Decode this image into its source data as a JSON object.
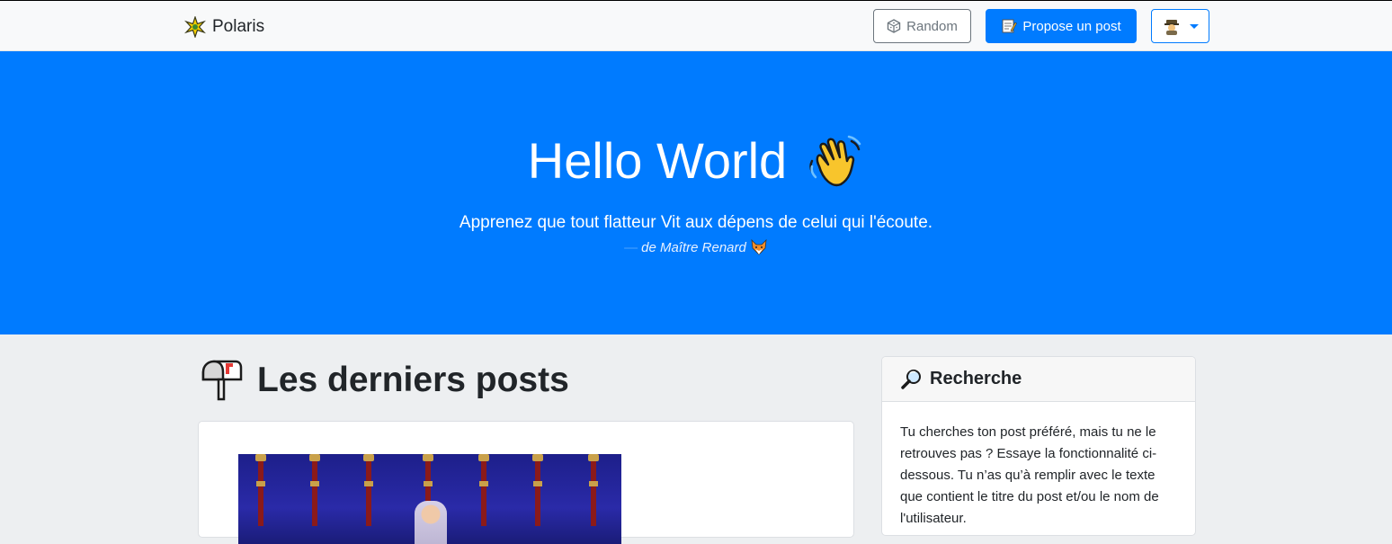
{
  "navbar": {
    "brand": "Polaris",
    "brand_icon": "sparkle-star-icon",
    "random_label": "Random",
    "random_icon": "dice-icon",
    "propose_label": "Propose un post",
    "propose_icon": "memo-icon",
    "user_icon": "detective-avatar-icon"
  },
  "hero": {
    "title": "Hello World",
    "title_icon": "waving-hand-icon",
    "quote": "Apprenez que tout flatteur Vit aux dépens de celui qui l'écoute.",
    "cite": "de Maître Renard",
    "cite_dash": "—",
    "cite_icon": "fox-icon"
  },
  "posts": {
    "title": "Les derniers posts",
    "title_icon": "mailbox-icon"
  },
  "search": {
    "title": "Recherche",
    "title_icon": "magnifier-icon",
    "description": "Tu cherches ton post préféré, mais tu ne le retrouves pas ? Essaye la fonctionnalité ci-dessous. Tu n’as qu’à remplir avec le texte que contient le titre du post et/ou le nom de l'utilisateur."
  },
  "colors": {
    "primary": "#007bff",
    "navbar_bg": "#f8f9fa",
    "page_bg": "#edeff1",
    "secondary": "#6c757d"
  }
}
